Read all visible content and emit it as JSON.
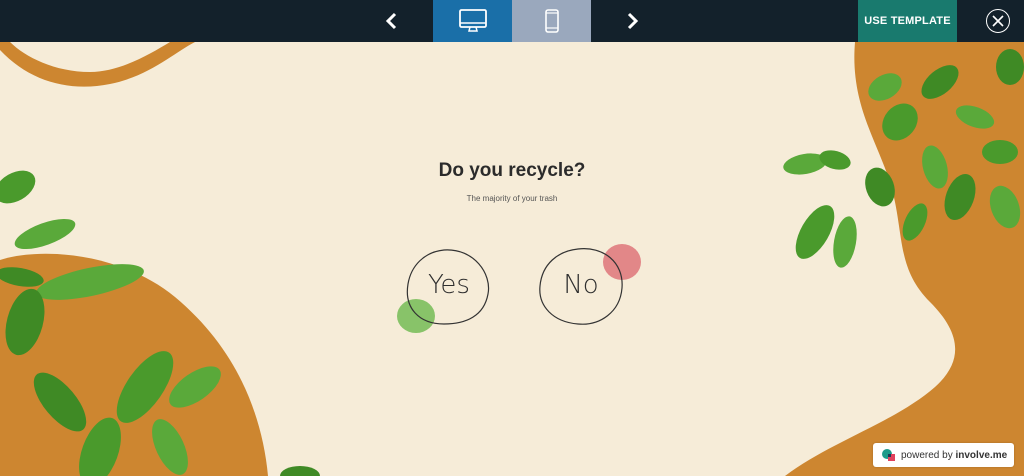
{
  "toolbar": {
    "prev_icon": "chevron-left-icon",
    "next_icon": "chevron-right-icon",
    "desktop_icon": "desktop-icon",
    "mobile_icon": "mobile-icon",
    "use_template_label": "USE TEMPLATE",
    "close_icon": "close-icon",
    "colors": {
      "bar": "#13212b",
      "desktop_active": "#1a6fa8",
      "mobile": "#9aa8bd",
      "use_template": "#197a6e"
    }
  },
  "question": {
    "title": "Do you recycle?",
    "subtitle": "The majority of your trash",
    "answers": [
      {
        "label": "Yes",
        "accent": "#7cbf5d"
      },
      {
        "label": "No",
        "accent": "#e07c80"
      }
    ]
  },
  "footer": {
    "powered_by": "powered by",
    "brand": "involve.me"
  },
  "colors": {
    "background": "#f6ecd8",
    "shape": "#cd8630",
    "leaf": "#4a9a2c"
  }
}
